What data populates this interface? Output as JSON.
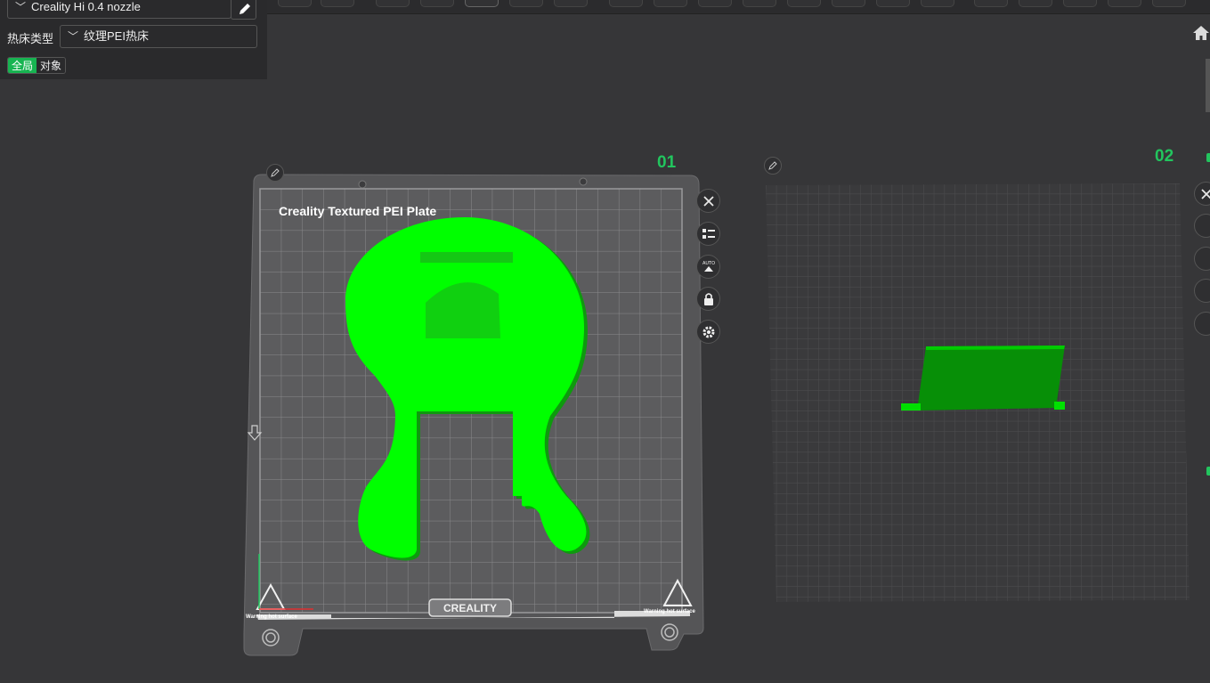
{
  "left_panel": {
    "nozzle_value": "Creality Hi 0.4 nozzle",
    "bed_type_label": "热床类型",
    "bed_type_value": "纹理PEI热床",
    "scope_global": "全局",
    "scope_object": "对象"
  },
  "plates": [
    {
      "number": "01",
      "bed_label": "Creality Textured PEI Plate",
      "logo": "CREALITY",
      "warning": "Warning hot surface"
    },
    {
      "number": "02"
    }
  ],
  "colors": {
    "accent": "#22c55e",
    "model": "#00ff00",
    "background": "#363638"
  },
  "icons": [
    "chevron-down-icon",
    "edit-icon",
    "close-icon",
    "arrange-icon",
    "auto-orient-icon",
    "lock-icon",
    "gear-icon",
    "home-icon"
  ],
  "side_buttons": {
    "auto_label": "AUTO"
  }
}
